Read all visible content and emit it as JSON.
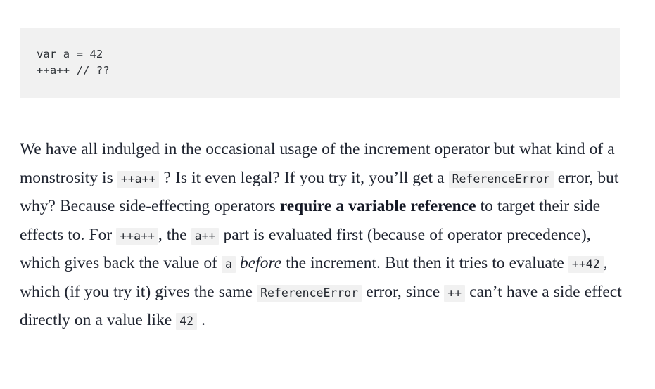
{
  "page": {
    "background_color": "#ffffff",
    "text_color": "#1f2430",
    "code_background_color": "#f1f1f1",
    "code_text_color": "#2f3338"
  },
  "code_block": {
    "language": "javascript",
    "lines": [
      "var a = 42",
      "++a++ // ??"
    ],
    "text": "var a = 42\n++a++ // ??"
  },
  "paragraph": {
    "segments": [
      {
        "type": "text",
        "value": "We have all indulged in the occasional usage of the increment operator but what kind of a monstrosity is "
      },
      {
        "type": "code",
        "value": "++a++"
      },
      {
        "type": "text",
        "value": " ? Is it even legal? If you try it, you’ll get a "
      },
      {
        "type": "code",
        "value": "ReferenceError"
      },
      {
        "type": "text",
        "value": " error, but why? Because side-effecting operators "
      },
      {
        "type": "bold",
        "value": "require a variable reference"
      },
      {
        "type": "text",
        "value": " to target their side effects to. For "
      },
      {
        "type": "code",
        "value": "++a++"
      },
      {
        "type": "text",
        "value": ", the "
      },
      {
        "type": "code",
        "value": "a++"
      },
      {
        "type": "text",
        "value": " part is evaluated first (because of operator precedence), which gives back the value of "
      },
      {
        "type": "code",
        "value": "a"
      },
      {
        "type": "text",
        "value": " "
      },
      {
        "type": "italic",
        "value": "before"
      },
      {
        "type": "text",
        "value": " the increment. But then it tries to evaluate "
      },
      {
        "type": "code",
        "value": "++42"
      },
      {
        "type": "text",
        "value": ", which (if you try it) gives the same "
      },
      {
        "type": "code",
        "value": "ReferenceError"
      },
      {
        "type": "text",
        "value": " error, since "
      },
      {
        "type": "code",
        "value": "++"
      },
      {
        "type": "text",
        "value": " can’t have a side effect directly on a value like "
      },
      {
        "type": "code",
        "value": "42"
      },
      {
        "type": "text",
        "value": " ."
      }
    ],
    "t1": "We have all indulged in the occasional usage of the increment operator but what kind of a monstrosity is ",
    "c1": "++a++",
    "t2": " ? Is it even legal? If you try it, you’ll get a ",
    "c2": "ReferenceError",
    "t3": " error, but why? Because side-effecting operators ",
    "b1": "require a variable reference",
    "t4": " to target their side effects to. For ",
    "c3": "++a++",
    "t5": ", the ",
    "c4": "a++",
    "t6": " part is evaluated first (because of operator precedence), which gives back the value of ",
    "c5": "a",
    "t7": " ",
    "i1": "before",
    "t8": " the increment. But then it tries to evaluate ",
    "c6": "++42",
    "t9": ", which (if you try it) gives the same ",
    "c7": "ReferenceError",
    "t10": " error, since ",
    "c8": "++",
    "t11": " can’t have a side effect directly on a value like ",
    "c9": "42",
    "t12": " ."
  }
}
